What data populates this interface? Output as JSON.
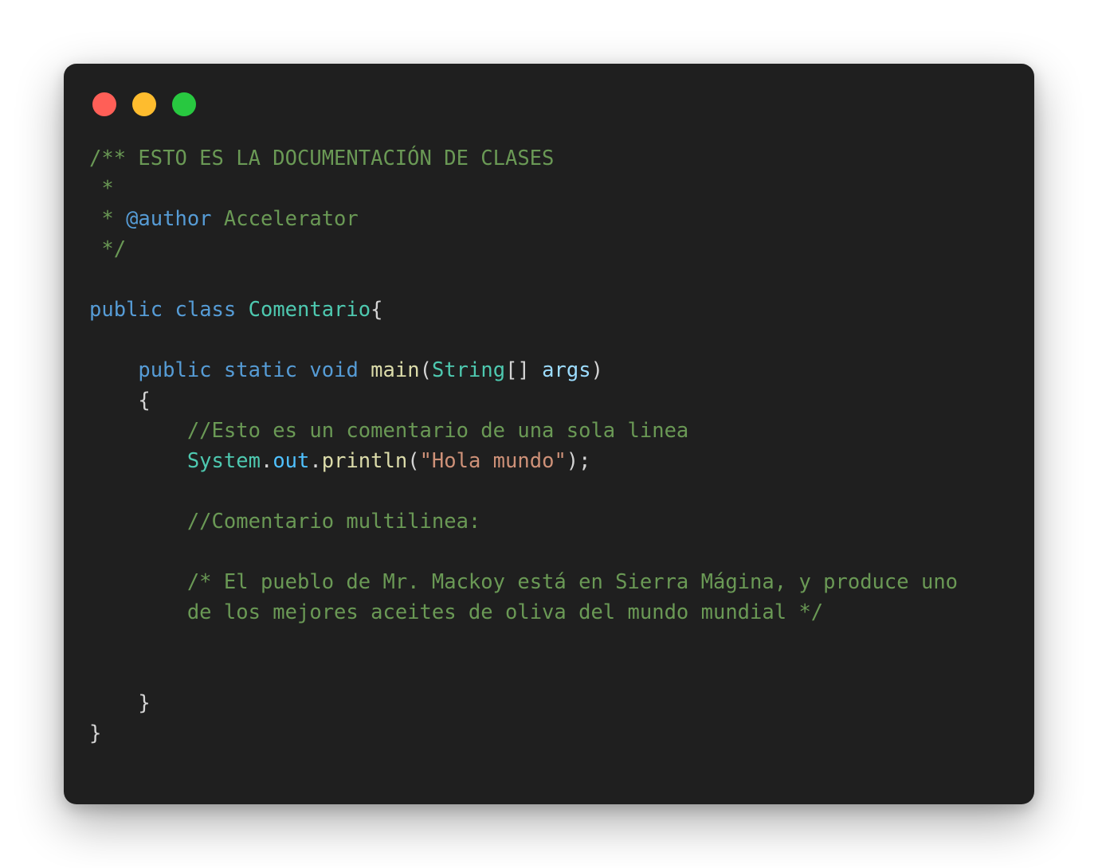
{
  "window": {
    "controls": [
      {
        "name": "close",
        "color": "#ff5f57"
      },
      {
        "name": "minimize",
        "color": "#febc2e"
      },
      {
        "name": "maximize",
        "color": "#28c840"
      }
    ]
  },
  "code": {
    "lines": [
      [
        {
          "t": "/** ESTO ES LA DOCUMENTACIÓN DE CLASES",
          "k": "comment"
        }
      ],
      [
        {
          "t": " *",
          "k": "comment"
        }
      ],
      [
        {
          "t": " * ",
          "k": "comment"
        },
        {
          "t": "@author",
          "k": "tag"
        },
        {
          "t": " Accelerator",
          "k": "comment"
        }
      ],
      [
        {
          "t": " */",
          "k": "comment"
        }
      ],
      [],
      [
        {
          "t": "public",
          "k": "keyword"
        },
        {
          "t": " ",
          "k": "punct"
        },
        {
          "t": "class",
          "k": "keyword"
        },
        {
          "t": " ",
          "k": "punct"
        },
        {
          "t": "Comentario",
          "k": "type"
        },
        {
          "t": "{",
          "k": "punct"
        }
      ],
      [],
      [
        {
          "t": "    ",
          "k": "punct"
        },
        {
          "t": "public",
          "k": "keyword"
        },
        {
          "t": " ",
          "k": "punct"
        },
        {
          "t": "static",
          "k": "keyword"
        },
        {
          "t": " ",
          "k": "punct"
        },
        {
          "t": "void",
          "k": "keyword"
        },
        {
          "t": " ",
          "k": "punct"
        },
        {
          "t": "main",
          "k": "func"
        },
        {
          "t": "(",
          "k": "punct"
        },
        {
          "t": "String",
          "k": "type"
        },
        {
          "t": "[] ",
          "k": "punct"
        },
        {
          "t": "args",
          "k": "param"
        },
        {
          "t": ")",
          "k": "punct"
        }
      ],
      [
        {
          "t": "    {",
          "k": "punct"
        }
      ],
      [
        {
          "t": "        ",
          "k": "punct"
        },
        {
          "t": "//Esto es un comentario de una sola linea",
          "k": "comment"
        }
      ],
      [
        {
          "t": "        ",
          "k": "punct"
        },
        {
          "t": "System",
          "k": "type"
        },
        {
          "t": ".",
          "k": "punct"
        },
        {
          "t": "out",
          "k": "field"
        },
        {
          "t": ".",
          "k": "punct"
        },
        {
          "t": "println",
          "k": "func"
        },
        {
          "t": "(",
          "k": "punct"
        },
        {
          "t": "\"Hola mundo\"",
          "k": "string"
        },
        {
          "t": ");",
          "k": "punct"
        }
      ],
      [],
      [
        {
          "t": "        ",
          "k": "punct"
        },
        {
          "t": "//Comentario multilinea:",
          "k": "comment"
        }
      ],
      [],
      [
        {
          "t": "        ",
          "k": "punct"
        },
        {
          "t": "/* El pueblo de Mr. Mackoy está en Sierra Mágina, y produce uno",
          "k": "comment"
        }
      ],
      [
        {
          "t": "        ",
          "k": "punct"
        },
        {
          "t": "de los mejores aceites de oliva del mundo mundial */",
          "k": "comment"
        }
      ],
      [],
      [],
      [
        {
          "t": "    }",
          "k": "punct"
        }
      ],
      [
        {
          "t": "}",
          "k": "punct"
        }
      ]
    ]
  }
}
